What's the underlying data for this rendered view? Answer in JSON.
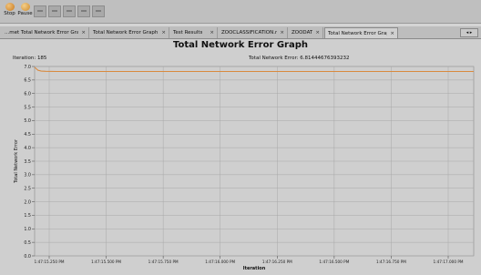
{
  "toolbar": {
    "stop_label": "Stop",
    "pause_label": "Pause",
    "extra_buttons": [
      "tool-1-icon",
      "tool-2-icon",
      "tool-3-icon",
      "tool-4-icon",
      "tool-5-icon"
    ]
  },
  "tabs": [
    {
      "label": "...met  Total Network Error Graph",
      "active": false
    },
    {
      "label": "Total Network Error Graph",
      "active": false
    },
    {
      "label": "Test Results",
      "active": false
    },
    {
      "label": "ZOOCLASSIFICATION.nnet",
      "active": false
    },
    {
      "label": "ZOODAT",
      "active": false
    },
    {
      "label": "Total Network Error Graph",
      "active": true
    }
  ],
  "tab_close_glyph": "×",
  "tab_nav": "◂ ▸",
  "header": {
    "iteration_label": "Iteration:",
    "iteration_value": "185",
    "error_label": "Total Network Error:",
    "error_value": "6.81444676393232"
  },
  "colors": {
    "series": "#d98a3f",
    "grid": "#a8a8a8",
    "background": "#cfcfcf"
  },
  "chart_data": {
    "type": "line",
    "title": "Total Network Error Graph",
    "xlabel": "Iteration",
    "ylabel": "Total Network Error",
    "ylim": [
      0,
      7
    ],
    "yticks": [
      "0.0",
      "0.5",
      "1.0",
      "1.5",
      "2.0",
      "2.5",
      "3.0",
      "3.5",
      "4.0",
      "4.5",
      "5.0",
      "5.5",
      "6.0",
      "6.5",
      "7.0"
    ],
    "x_ticklabels": [
      "1:47:15.250 PM",
      "1:47:15.500 PM",
      "1:47:15.750 PM",
      "1:47:16.000 PM",
      "1:47:16.250 PM",
      "1:47:16.500 PM",
      "1:47:16.750 PM",
      "1:47:17.000 PM"
    ],
    "grid": true,
    "series": [
      {
        "values": [
          [
            0,
            6.97
          ],
          [
            0.03,
            6.86
          ],
          [
            0.06,
            6.83
          ],
          [
            0.1,
            6.82
          ],
          [
            0.2,
            6.815
          ],
          [
            0.4,
            6.815
          ],
          [
            0.6,
            6.815
          ],
          [
            0.8,
            6.815
          ],
          [
            1.0,
            6.815
          ],
          [
            1.2,
            6.815
          ],
          [
            1.4,
            6.815
          ],
          [
            1.6,
            6.815
          ],
          [
            1.8,
            6.815
          ],
          [
            2.0,
            6.815
          ],
          [
            2.2,
            6.815
          ],
          [
            2.4,
            6.815
          ],
          [
            2.6,
            6.815
          ],
          [
            2.8,
            6.815
          ],
          [
            3.0,
            6.815
          ],
          [
            3.2,
            6.815
          ],
          [
            3.4,
            6.815
          ],
          [
            3.6,
            6.815
          ],
          [
            3.8,
            6.815
          ],
          [
            4.0,
            6.815
          ]
        ]
      }
    ]
  }
}
